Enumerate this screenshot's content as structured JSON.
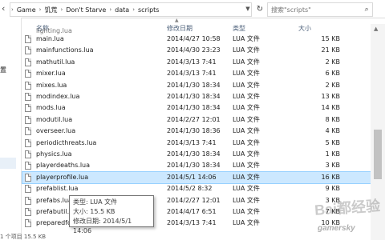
{
  "address_bar": {
    "breadcrumbs": [
      "Game",
      "饥荒",
      "Don't Starve",
      "data",
      "scripts"
    ],
    "search_placeholder": "搜索\"scripts\""
  },
  "nav_pane": {
    "partial_text": "置"
  },
  "columns": {
    "name": "名称",
    "date": "修改日期",
    "type": "类型",
    "size": "大小"
  },
  "partial_top_row": "lighting.lua",
  "files": [
    {
      "name": "main.lua",
      "date": "2014/4/27 10:58",
      "type": "LUA 文件",
      "size": "15 KB"
    },
    {
      "name": "mainfunctions.lua",
      "date": "2014/4/30 23:23",
      "type": "LUA 文件",
      "size": "21 KB"
    },
    {
      "name": "mathutil.lua",
      "date": "2014/3/13 7:41",
      "type": "LUA 文件",
      "size": "2 KB"
    },
    {
      "name": "mixer.lua",
      "date": "2014/3/13 7:41",
      "type": "LUA 文件",
      "size": "6 KB"
    },
    {
      "name": "mixes.lua",
      "date": "2014/1/30 18:34",
      "type": "LUA 文件",
      "size": "2 KB"
    },
    {
      "name": "modindex.lua",
      "date": "2014/1/30 18:34",
      "type": "LUA 文件",
      "size": "13 KB"
    },
    {
      "name": "mods.lua",
      "date": "2014/1/30 18:34",
      "type": "LUA 文件",
      "size": "14 KB"
    },
    {
      "name": "modutil.lua",
      "date": "2014/2/27 12:01",
      "type": "LUA 文件",
      "size": "8 KB"
    },
    {
      "name": "overseer.lua",
      "date": "2014/1/30 18:36",
      "type": "LUA 文件",
      "size": "4 KB"
    },
    {
      "name": "periodicthreats.lua",
      "date": "2014/3/13 7:41",
      "type": "LUA 文件",
      "size": "5 KB"
    },
    {
      "name": "physics.lua",
      "date": "2014/1/30 18:34",
      "type": "LUA 文件",
      "size": "1 KB"
    },
    {
      "name": "playerdeaths.lua",
      "date": "2014/1/30 18:34",
      "type": "LUA 文件",
      "size": "3 KB"
    },
    {
      "name": "playerprofile.lua",
      "date": "2014/5/1 14:06",
      "type": "LUA 文件",
      "size": "16 KB",
      "selected": true
    },
    {
      "name": "prefablist.lua",
      "date": "2014/5/2 8:32",
      "type": "LUA 文件",
      "size": "9 KB"
    },
    {
      "name": "prefabs.lua",
      "date": "2014/2/27 12:01",
      "type": "LUA 文件",
      "size": "3 KB"
    },
    {
      "name": "prefabutil.lua",
      "date": "2014/4/17 6:51",
      "type": "LUA 文件",
      "size": "7 KB"
    },
    {
      "name": "preparedfoods.lua",
      "date": "2014/3/13 7:41",
      "type": "LUA 文件",
      "size": "10 KB"
    }
  ],
  "tooltip": {
    "type_line": "类型: LUA 文件",
    "size_line": "大小: 15.5 KB",
    "date_line": "修改日期: 2014/5/1 14:06"
  },
  "status_bar": "1 个项目  15.5 KB",
  "watermark": {
    "main": "Bai都经验",
    "sub": "gamersky"
  }
}
